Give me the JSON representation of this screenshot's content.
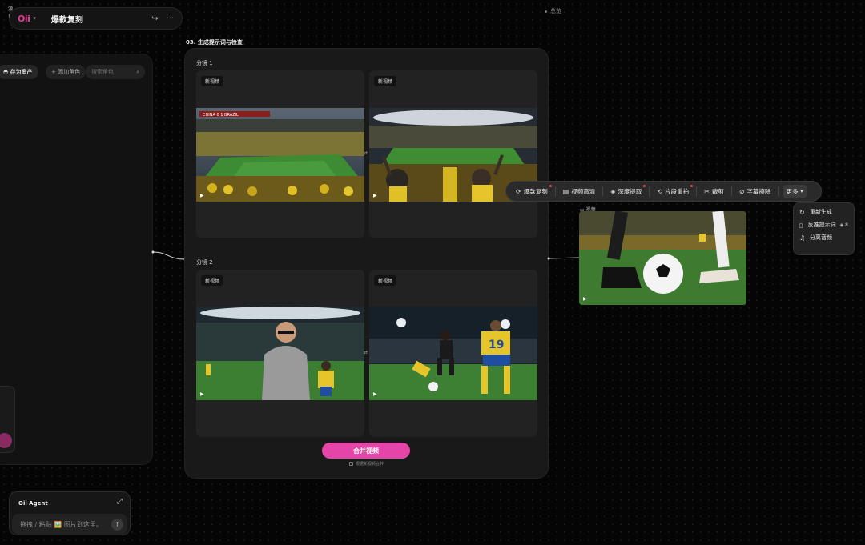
{
  "header": {
    "logo": "Oii",
    "title": "爆款复刻",
    "share_icon": "share-icon",
    "more_icon": "more-icon"
  },
  "overview": {
    "label": "总览"
  },
  "left_panel": {
    "save_asset": "存为资产",
    "add_role": "+ 添加角色",
    "search_placeholder": "搜索角色",
    "side_card_text": "源\n!"
  },
  "center": {
    "section_label": "03. 生成提示词与检查",
    "shots": [
      {
        "label": "分镜 1",
        "cards": [
          {
            "tag": "新视频",
            "scoreboard": "CHINA 0 1 BRAZIL"
          },
          {
            "tag": "新视频"
          }
        ]
      },
      {
        "label": "分镜 2",
        "cards": [
          {
            "tag": "新视频"
          },
          {
            "tag": "新视频",
            "jersey_number": "19"
          }
        ]
      }
    ],
    "merge_button": "合并视频",
    "auto_checkbox": "根据新视频合并"
  },
  "toolbar": {
    "items": [
      {
        "label": "爆款复刻",
        "icon": "remix-icon",
        "dot": true
      },
      {
        "label": "视频高清",
        "icon": "hd-icon",
        "dot": false
      },
      {
        "label": "深度提取",
        "icon": "layers-icon",
        "dot": true
      },
      {
        "label": "片段重拍",
        "icon": "reshoot-icon",
        "dot": true
      },
      {
        "label": "裁剪",
        "icon": "scissors-icon",
        "dot": false
      },
      {
        "label": "字幕擦除",
        "icon": "erase-subtitle-icon",
        "dot": false
      }
    ],
    "more": "更多"
  },
  "more_menu": {
    "items": [
      {
        "label": "重新生成",
        "icon": "refresh-icon"
      },
      {
        "label": "反推提示词",
        "icon": "clipboard-icon",
        "badge": "8"
      },
      {
        "label": "分离音频",
        "icon": "audio-split-icon"
      }
    ]
  },
  "output_node": {
    "label": "视频"
  },
  "agent": {
    "title": "Oii Agent",
    "placeholder": "拖拽 / 粘贴 🖼️ 图片到这里。"
  },
  "colors": {
    "accent": "#e545a8",
    "logo": "#e23b8e",
    "brazil_yellow": "#f5c518",
    "pitch_green": "#2f7a2a"
  }
}
